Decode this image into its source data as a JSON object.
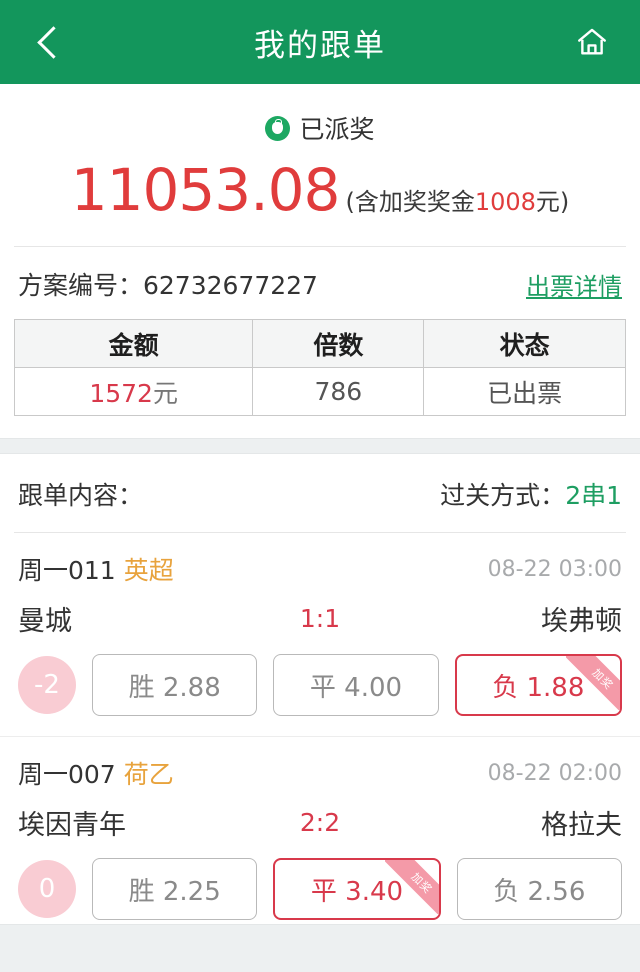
{
  "header": {
    "back_icon": "chevron-left-icon",
    "title": "我的跟单",
    "home_icon": "home-icon"
  },
  "prize": {
    "coin_icon": "money-bag-icon",
    "status": "已派奖",
    "amount": "11053.08",
    "sub_prefix": "(含加奖奖金",
    "bonus": "1008",
    "sub_suffix": "元)"
  },
  "scheme": {
    "label": "方案编号：62732677227",
    "detail_link": "出票详情"
  },
  "table": {
    "headers": [
      "金额",
      "倍数",
      "状态"
    ],
    "amount_value": "1572",
    "amount_unit": "元",
    "multiple": "786",
    "status": "已出票"
  },
  "content": {
    "title": "跟单内容：",
    "pass_label": "过关方式：",
    "pass_value": "2串1"
  },
  "matches": [
    {
      "no": "周一011",
      "league": "英超",
      "time": "08-22 03:00",
      "home": "曼城",
      "score": "1:1",
      "away": "埃弗顿",
      "handicap": "-2",
      "options": [
        {
          "label": "胜 2.88",
          "selected": false,
          "ribbon": ""
        },
        {
          "label": "平 4.00",
          "selected": false,
          "ribbon": ""
        },
        {
          "label": "负 1.88",
          "selected": true,
          "ribbon": "加奖"
        }
      ]
    },
    {
      "no": "周一007",
      "league": "荷乙",
      "time": "08-22 02:00",
      "home": "埃因青年",
      "score": "2:2",
      "away": "格拉夫",
      "handicap": "0",
      "options": [
        {
          "label": "胜 2.25",
          "selected": false,
          "ribbon": ""
        },
        {
          "label": "平 3.40",
          "selected": true,
          "ribbon": "加奖"
        },
        {
          "label": "负 2.56",
          "selected": false,
          "ribbon": ""
        }
      ]
    }
  ],
  "colors": {
    "brand_green": "#13965c",
    "accent_red": "#d8394b",
    "league_orange": "#e8a33d",
    "link_green": "#1e9e62",
    "handicap_pink": "#f9ccd3"
  }
}
